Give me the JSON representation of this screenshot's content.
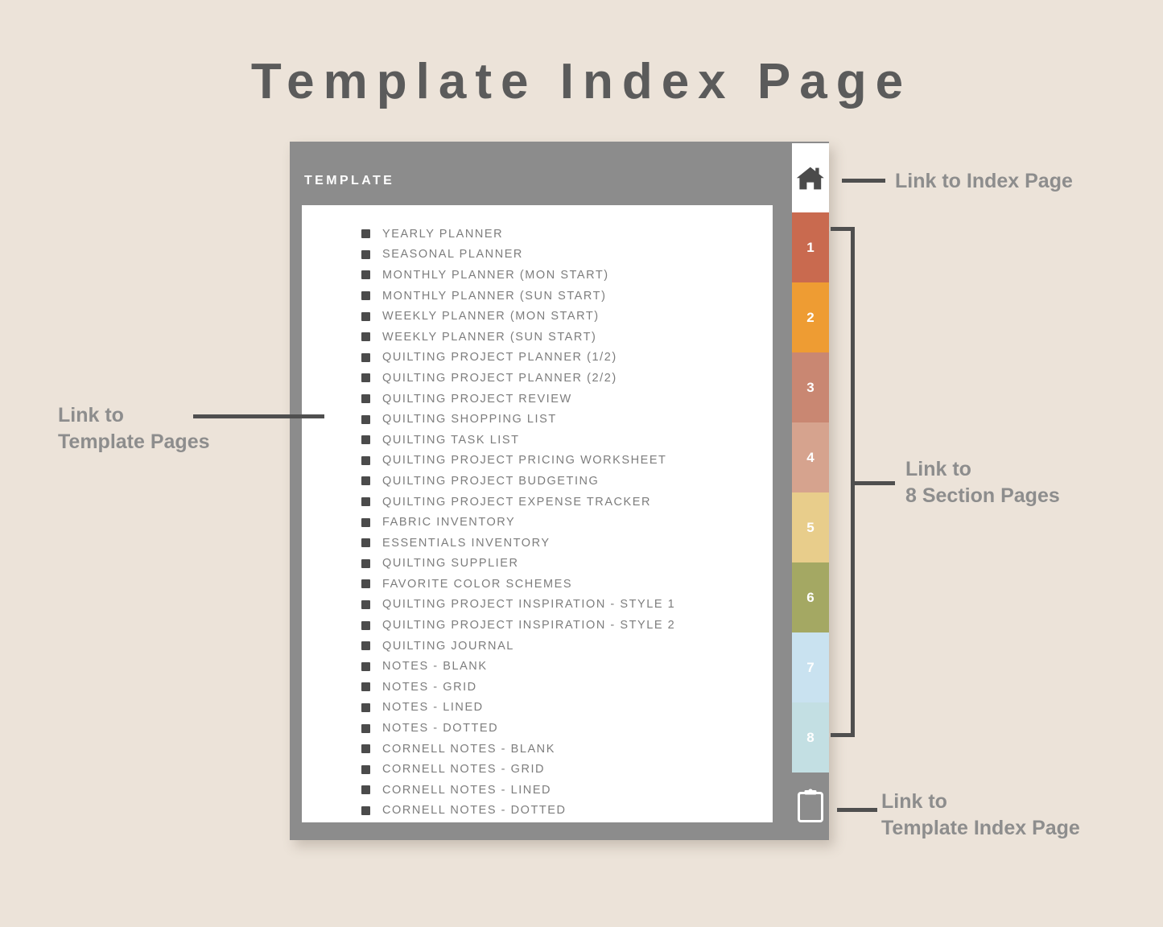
{
  "page": {
    "title": "Template Index Page",
    "background_color": "#ece3d9",
    "title_color": "#5b5b5b"
  },
  "device": {
    "frame_color": "#8c8c8c",
    "card_color": "#ffffff",
    "section_header": "TEMPLATE"
  },
  "template_list": {
    "items": [
      {
        "label": "YEARLY PLANNER"
      },
      {
        "label": "SEASONAL PLANNER"
      },
      {
        "label": "MONTHLY PLANNER (MON START)"
      },
      {
        "label": "MONTHLY PLANNER (SUN START)"
      },
      {
        "label": "WEEKLY PLANNER (MON START)"
      },
      {
        "label": "WEEKLY PLANNER (SUN START)"
      },
      {
        "label": "QUILTING PROJECT PLANNER (1/2)"
      },
      {
        "label": "QUILTING PROJECT PLANNER (2/2)"
      },
      {
        "label": "QUILTING PROJECT REVIEW"
      },
      {
        "label": "QUILTING SHOPPING LIST"
      },
      {
        "label": "QUILTING TASK LIST"
      },
      {
        "label": "QUILTING PROJECT PRICING WORKSHEET"
      },
      {
        "label": "QUILTING PROJECT BUDGETING"
      },
      {
        "label": "QUILTING PROJECT EXPENSE TRACKER"
      },
      {
        "label": "FABRIC INVENTORY"
      },
      {
        "label": "ESSENTIALS INVENTORY"
      },
      {
        "label": "QUILTING SUPPLIER"
      },
      {
        "label": "FAVORITE COLOR SCHEMES"
      },
      {
        "label": "QUILTING PROJECT INSPIRATION - STYLE 1"
      },
      {
        "label": "QUILTING PROJECT INSPIRATION - STYLE 2"
      },
      {
        "label": "QUILTING JOURNAL"
      },
      {
        "label": "NOTES - BLANK"
      },
      {
        "label": "NOTES - GRID"
      },
      {
        "label": "NOTES - LINED"
      },
      {
        "label": "NOTES - DOTTED"
      },
      {
        "label": "CORNELL NOTES - BLANK"
      },
      {
        "label": "CORNELL NOTES - GRID"
      },
      {
        "label": "CORNELL NOTES - LINED"
      },
      {
        "label": "CORNELL NOTES - DOTTED"
      }
    ]
  },
  "tabs": {
    "home": {
      "icon": "home-icon",
      "background": "#ffffff",
      "icon_color": "#4b4b4b"
    },
    "numbered": [
      {
        "label": "1",
        "color": "#c96a4f"
      },
      {
        "label": "2",
        "color": "#ee9c33"
      },
      {
        "label": "3",
        "color": "#c98772"
      },
      {
        "label": "4",
        "color": "#d6a38e"
      },
      {
        "label": "5",
        "color": "#e8cd8b"
      },
      {
        "label": "6",
        "color": "#a4a863"
      },
      {
        "label": "7",
        "color": "#c9e2f0"
      },
      {
        "label": "8",
        "color": "#c3dfe3"
      }
    ],
    "clipboard": {
      "icon": "clipboard-icon",
      "background": "#8c8c8c",
      "icon_color": "#ffffff"
    }
  },
  "callouts": {
    "template_pages": "Link to\nTemplate Pages",
    "index_page": "Link to Index Page",
    "section_pages": "Link to\n8 Section Pages",
    "template_index_page": "Link to\nTemplate Index Page",
    "line_color": "#4f4f4f",
    "text_color": "#8d8d8d"
  }
}
